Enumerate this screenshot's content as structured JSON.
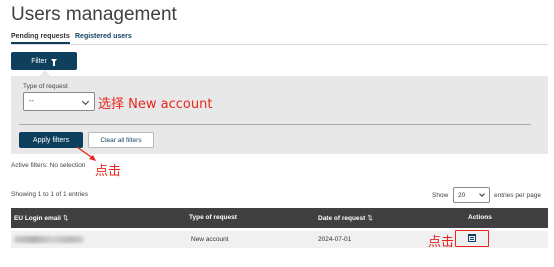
{
  "page": {
    "title": "Users management"
  },
  "tabs": [
    {
      "label": "Pending requests",
      "active": true
    },
    {
      "label": "Registered users",
      "active": false
    }
  ],
  "filter_button": {
    "label": "Filter",
    "icon": "funnel-icon"
  },
  "filter_panel": {
    "type_label": "Type of request",
    "type_value": "--",
    "apply_label": "Apply filters",
    "clear_label": "Clear all filters"
  },
  "annotations": {
    "select_hint": "选择 New account",
    "apply_hint": "点击",
    "action_hint": "点击",
    "color": "#e8261e"
  },
  "active_filters": {
    "label": "Active filters:",
    "value": "No selection"
  },
  "pagination": {
    "summary": "Showing 1 to 1 of 1 entries",
    "show_label": "Show",
    "page_size": "20",
    "per_page_label": "entries per page"
  },
  "table": {
    "headers": [
      {
        "label": "EU Login email",
        "sort_icon": "⇅"
      },
      {
        "label": "Type of request",
        "sort_icon": ""
      },
      {
        "label": "Date of request",
        "sort_icon": "⇅"
      },
      {
        "label": "Actions",
        "sort_icon": ""
      }
    ],
    "rows": [
      {
        "type": "New account",
        "date": "2024-07-01",
        "action_icon": "calendar-icon"
      }
    ]
  },
  "colors": {
    "primary": "#0e3f5d",
    "table_header": "#404040",
    "panel_bg": "#e8e8e8"
  }
}
